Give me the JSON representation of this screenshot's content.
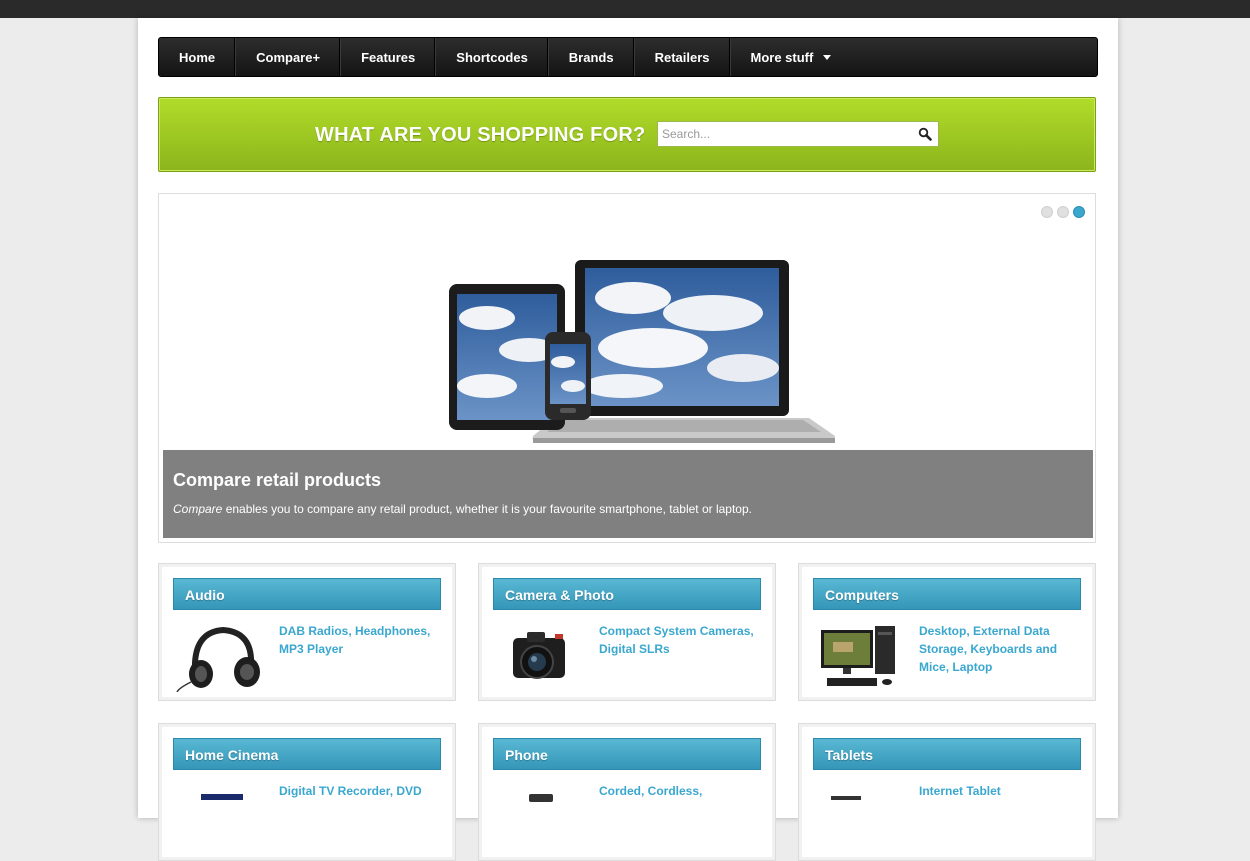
{
  "nav": {
    "items": [
      {
        "label": "Home"
      },
      {
        "label": "Compare+"
      },
      {
        "label": "Features"
      },
      {
        "label": "Shortcodes"
      },
      {
        "label": "Brands"
      },
      {
        "label": "Retailers"
      },
      {
        "label": "More stuff"
      }
    ]
  },
  "search": {
    "title": "WHAT ARE YOU SHOPPING FOR?",
    "placeholder": "Search..."
  },
  "slider": {
    "active_index": 3,
    "slide_count": 3,
    "caption_title": "Compare retail products",
    "caption_emphasis": "Compare",
    "caption_text": " enables you to compare any retail product, whether it is your favourite smartphone, tablet or laptop."
  },
  "categories": [
    {
      "title": "Audio",
      "links": [
        "DAB Radios",
        "Headphones",
        "MP3 Player"
      ],
      "image": "headphones"
    },
    {
      "title": "Camera & Photo",
      "links": [
        "Compact System Cameras",
        "Digital SLRs"
      ],
      "image": "dslr-camera"
    },
    {
      "title": "Computers",
      "links": [
        "Desktop",
        "External Data Storage",
        "Keyboards and Mice",
        "Laptop"
      ],
      "image": "desktop-computer"
    },
    {
      "title": "Home Cinema",
      "links": [
        "Digital TV Recorder",
        "DVD"
      ],
      "image": "tv"
    },
    {
      "title": "Phone",
      "links": [
        "Corded",
        "Cordless"
      ],
      "image": "phone"
    },
    {
      "title": "Tablets",
      "links": [
        "Internet Tablet"
      ],
      "image": "tablet"
    }
  ],
  "colors": {
    "accent": "#3aa7cf",
    "banner": "#9ccc22",
    "nav": "#1c1c1c"
  }
}
